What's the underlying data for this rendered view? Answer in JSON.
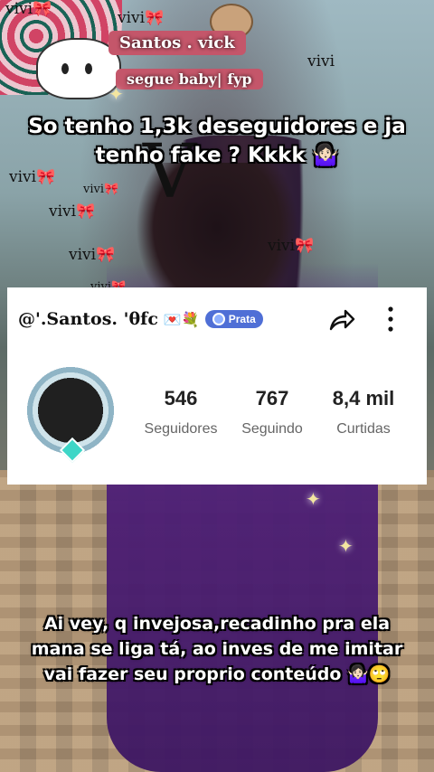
{
  "overlay": {
    "name_tag": "Santos . vick",
    "sub_tag": "segue baby| fyp",
    "vivi": "vivi",
    "bow": "🎀",
    "v": "V"
  },
  "captions": {
    "top_line1": "So tenho 1,3k deseguidores e ja",
    "top_line2": "tenho fake ? Kkkk 🤷🏻‍♀️",
    "bottom_line1": "Ai vey, q invejosa,recadinho pra ela",
    "bottom_line2": "mana se liga tá, ao inves de me imitar",
    "bottom_line3": "vai fazer seu proprio conteúdo 🤷🏻‍♀️🙄"
  },
  "profile": {
    "username": "@'.Santos. 'θfc",
    "emojis": "💌💐",
    "badge_label": "Prata",
    "stats": [
      {
        "value": "546",
        "label": "Seguidores"
      },
      {
        "value": "767",
        "label": "Seguindo"
      },
      {
        "value": "8,4 mil",
        "label": "Curtidas"
      }
    ]
  },
  "icons": {
    "share": "share-icon",
    "more": "more-vertical-icon",
    "badge": "badge-icon"
  },
  "colors": {
    "badge_bg": "#4f6fd6",
    "tag_bg": "#c4566a",
    "outfit": "#4b1d74"
  }
}
